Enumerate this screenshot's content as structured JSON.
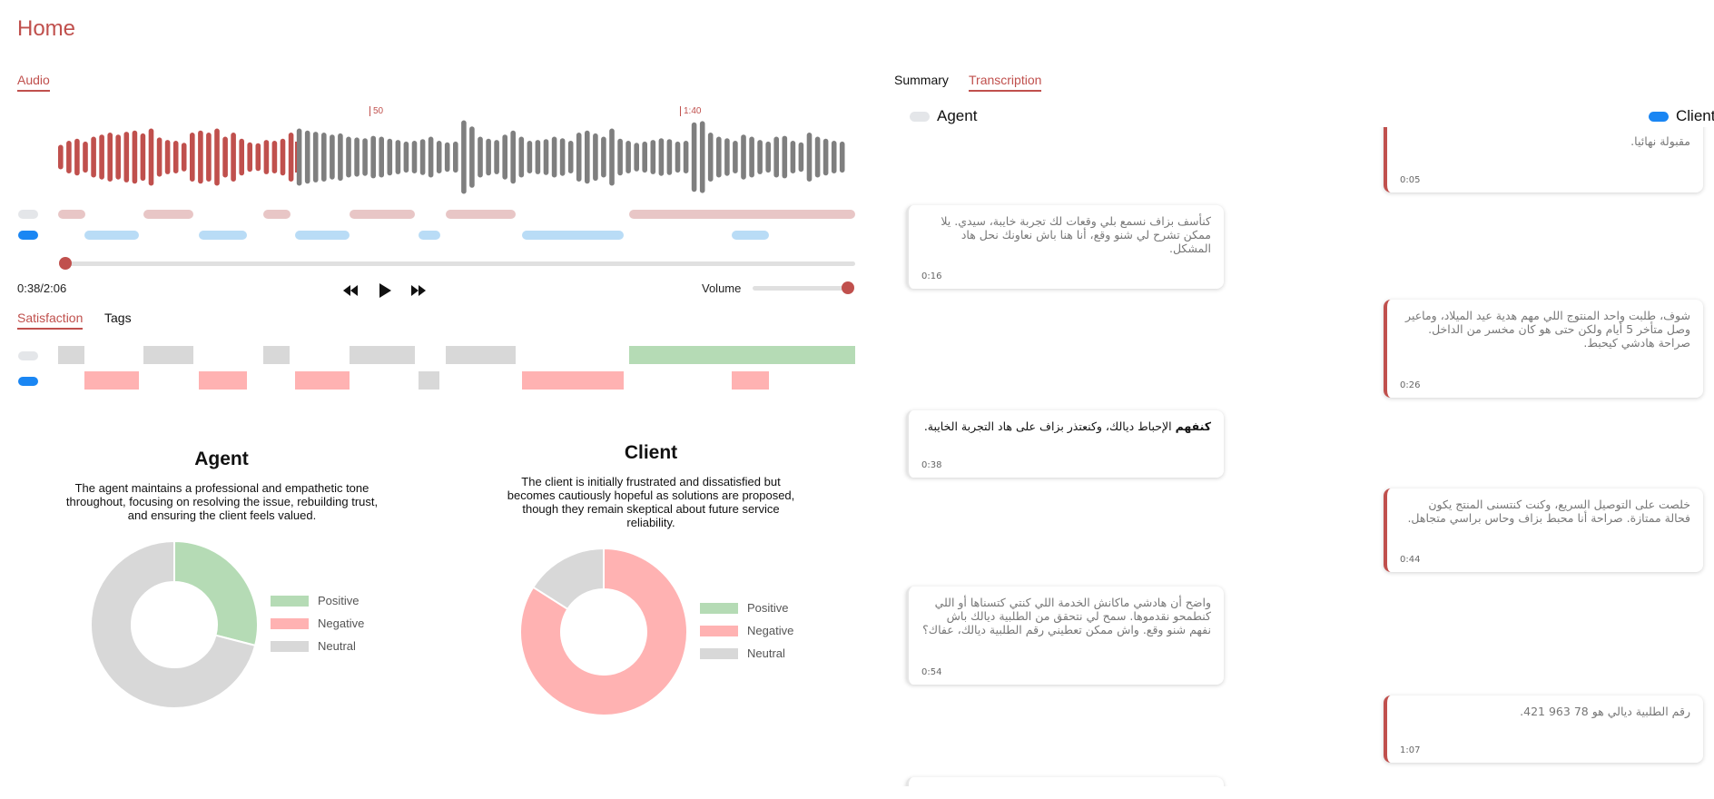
{
  "page": {
    "title": "Home"
  },
  "left_tabs": {
    "audio": "Audio"
  },
  "waveform": {
    "markers": [
      "50",
      "1:40"
    ],
    "played_color": "#c0504d",
    "unplayed_color": "#7f7f7f"
  },
  "player": {
    "time": "0:38/2:06",
    "progress_fraction": 0.3,
    "volume_label": "Volume",
    "volume_fraction": 0.97,
    "controls": [
      "rewind-icon",
      "play-icon",
      "fast-forward-icon"
    ]
  },
  "analysis_tabs": {
    "satisfaction": "Satisfaction",
    "tags": "Tags"
  },
  "colors": {
    "accent": "#c0504d",
    "agent_seg": "#e8c6c6",
    "client_seg": "#b9dcf6",
    "client_dot": "#1a86f3",
    "positive": "#b5dbb5",
    "negative": "#ffb2b2",
    "neutral": "#d8d8d8"
  },
  "summary": {
    "agent": {
      "title": "Agent",
      "text": "The agent maintains a professional and empathetic tone throughout, focusing on resolving the issue, rebuilding trust, and ensuring the client feels valued.",
      "legend": [
        "Positive",
        "Negative",
        "Neutral"
      ],
      "sentiment": {
        "positive": 0.29,
        "negative": 0,
        "neutral": 0.71
      }
    },
    "client": {
      "title": "Client",
      "text": "The client is initially frustrated and dissatisfied but becomes cautiously hopeful as solutions are proposed, though they remain skeptical about future service reliability.",
      "legend": [
        "Positive",
        "Negative",
        "Neutral"
      ],
      "sentiment": {
        "positive": 0,
        "negative": 0.84,
        "neutral": 0.16
      }
    }
  },
  "right_tabs": {
    "summary": "Summary",
    "transcription": "Transcription"
  },
  "filters": {
    "agent": "Agent",
    "client": "Client"
  },
  "transcript": [
    {
      "speaker": "client",
      "text": "مقبولة نهائيا.",
      "time": "0:05"
    },
    {
      "speaker": "agent",
      "text": "كنأسف بزاف نسمع بلي وقعات لك تجربة خايبة، سيدي. يلا ممكن تشرح لي شنو وقع، أنا هنا باش نعاونك نحل هاد المشكل.",
      "time": "0:16"
    },
    {
      "speaker": "client",
      "text": "شوف، طلبت واحد المنتوج اللي مهم هدية عيد الميلاد، وماعير وصل متأخر 5 أيام ولكن حتى هو كان مخسر من الداخل. صراحة هادشي كيحبط.",
      "time": "0:26"
    },
    {
      "speaker": "agent",
      "bold": "كنفهم",
      "text": " الإحباط ديالك، وكنعتذر بزاف على هاد التجربة الخايبة.",
      "time": "0:38"
    },
    {
      "speaker": "client",
      "text": "خلصت على التوصيل السريع، وكنت كنتسنى المنتج يكون فحالة ممتازة. صراحة أنا محبط بزاف وحاس براسي متجاهل.",
      "time": "0:44"
    },
    {
      "speaker": "agent",
      "text": "واضح أن هادشي ماكانش الخدمة اللي كنتي كتسناها أو اللي كنطمحو نقدموها. سمح لي نتحقق من الطلبية ديالك باش نفهم شنو وقع. واش ممكن تعطيني رقم الطلبية ديالك، عفاك؟",
      "time": "0:54"
    },
    {
      "speaker": "client",
      "text": "رقم الطلبية ديالي هو 78 963 421.",
      "time": "1:07"
    }
  ]
}
